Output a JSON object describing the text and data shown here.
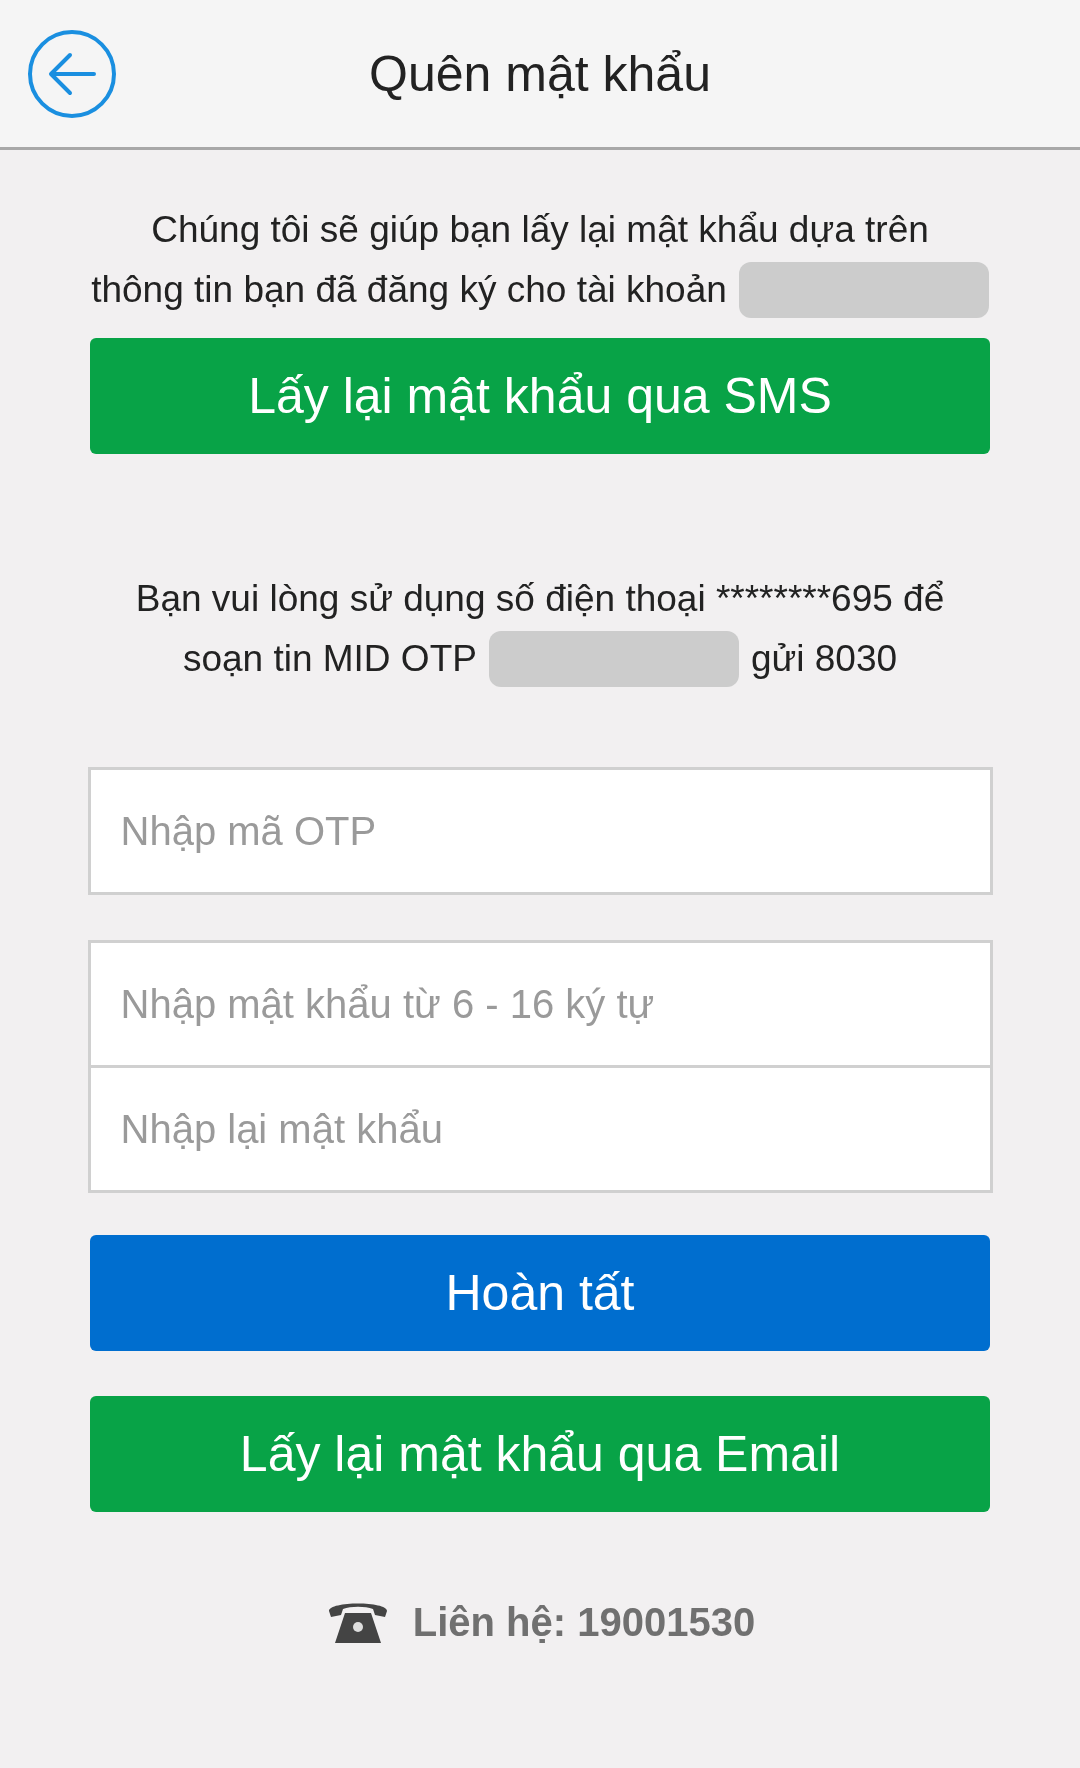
{
  "header": {
    "title": "Quên mật khẩu"
  },
  "intro": [
    [
      {
        "kind": "text",
        "text": "Chúng tôi sẽ giúp bạn lấy lại mật khẩu dựa trên"
      }
    ],
    [
      {
        "kind": "text",
        "text": "thông tin bạn đã đăng ký cho tài khoản"
      },
      {
        "kind": "redacted"
      }
    ]
  ],
  "sms_button": "Lấy lại mật khẩu qua SMS",
  "instruction": [
    [
      {
        "kind": "text",
        "text": "Bạn vui lòng sử dụng số điện thoại ********695 để"
      }
    ],
    [
      {
        "kind": "text",
        "text": "soạn tin MID OTP"
      },
      {
        "kind": "redacted"
      },
      {
        "kind": "text",
        "text": "gửi 8030"
      }
    ]
  ],
  "otp_field": {
    "placeholder": "Nhập mã OTP"
  },
  "password_fields": [
    {
      "placeholder": "Nhập mật khẩu từ 6 - 16 ký tự"
    },
    {
      "placeholder": "Nhập lại mật khẩu"
    }
  ],
  "done_button": "Hoàn tất",
  "email_button": "Lấy lại mật khẩu qua Email",
  "contact": "Liên hệ: 19001530"
}
